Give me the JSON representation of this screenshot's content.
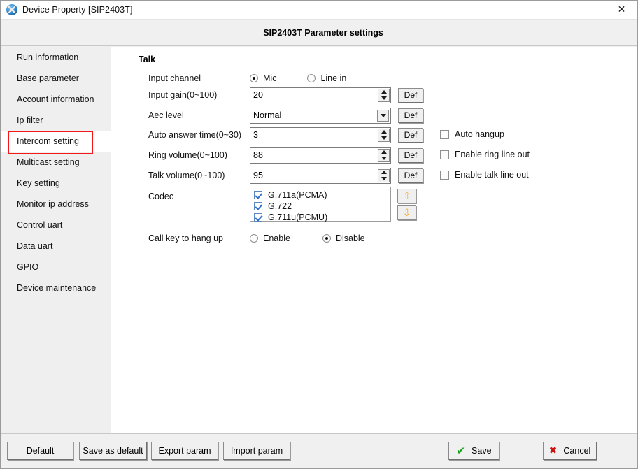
{
  "window": {
    "title": "Device Property [SIP2403T]",
    "icon": "globe-tools-icon",
    "close_label": "✕"
  },
  "header": {
    "title": "SIP2403T Parameter settings"
  },
  "sidebar": {
    "items": [
      {
        "label": "Run information",
        "active": false
      },
      {
        "label": "Base parameter",
        "active": false
      },
      {
        "label": "Account information",
        "active": false
      },
      {
        "label": "Ip filter",
        "active": false
      },
      {
        "label": "Intercom setting",
        "active": true
      },
      {
        "label": "Multicast setting",
        "active": false
      },
      {
        "label": "Key setting",
        "active": false
      },
      {
        "label": "Monitor ip address",
        "active": false
      },
      {
        "label": "Control uart",
        "active": false
      },
      {
        "label": "Data uart",
        "active": false
      },
      {
        "label": "GPIO",
        "active": false
      },
      {
        "label": "Device maintenance",
        "active": false
      }
    ],
    "highlight_color": "#f51818"
  },
  "main": {
    "section_title": "Talk",
    "input_channel": {
      "label": "Input channel",
      "options": [
        "Mic",
        "Line in"
      ],
      "selected": "Mic"
    },
    "input_gain": {
      "label": "Input gain(0~100)",
      "value": "20",
      "def_label": "Def"
    },
    "aec_level": {
      "label": "Aec level",
      "value": "Normal",
      "def_label": "Def"
    },
    "auto_answer_time": {
      "label": "Auto answer time(0~30)",
      "value": "3",
      "def_label": "Def"
    },
    "ring_volume": {
      "label": "Ring volume(0~100)",
      "value": "88",
      "def_label": "Def"
    },
    "talk_volume": {
      "label": "Talk volume(0~100)",
      "value": "95",
      "def_label": "Def"
    },
    "codec": {
      "label": "Codec",
      "items": [
        {
          "label": "G.711a(PCMA)",
          "checked": true
        },
        {
          "label": "G.722",
          "checked": true
        },
        {
          "label": "G.711u(PCMU)",
          "checked": true
        }
      ],
      "move_up": "⇧",
      "move_down": "⇩"
    },
    "call_key_hang_up": {
      "label": "Call key to hang up",
      "options": [
        "Enable",
        "Disable"
      ],
      "selected": "Disable"
    },
    "checkboxes": [
      {
        "label": "Auto hangup",
        "checked": false
      },
      {
        "label": "Enable ring line out",
        "checked": false
      },
      {
        "label": "Enable talk line out",
        "checked": false
      }
    ]
  },
  "footer": {
    "default_label": "Default",
    "save_as_default_label": "Save as default",
    "export_label": "Export param",
    "import_label": "Import param",
    "save_label": "Save",
    "save_icon": "✔",
    "cancel_label": "Cancel",
    "cancel_icon": "✖"
  }
}
